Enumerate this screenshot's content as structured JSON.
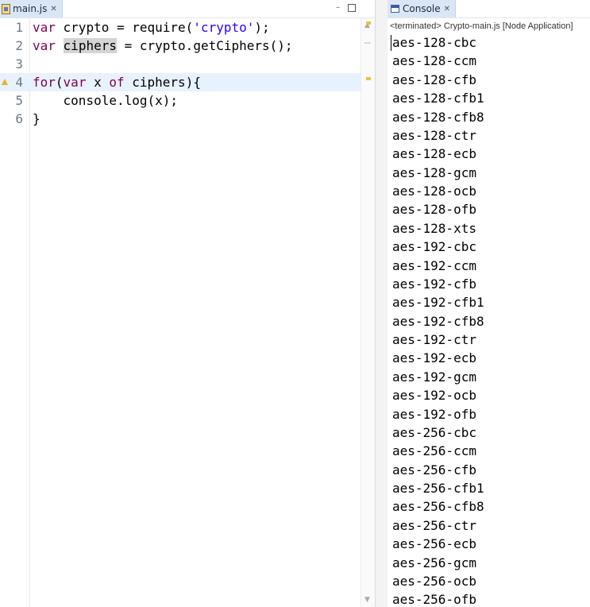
{
  "editor": {
    "tab_title": "main.js",
    "tab_close": "✕",
    "minimize": "–",
    "lines": [
      {
        "num": "1",
        "segments": [
          {
            "t": "var",
            "c": "kw"
          },
          {
            "t": " crypto = require(",
            "c": ""
          },
          {
            "t": "'crypto'",
            "c": "str"
          },
          {
            "t": ");",
            "c": ""
          }
        ]
      },
      {
        "num": "2",
        "segments": [
          {
            "t": "var",
            "c": "kw"
          },
          {
            "t": " ",
            "c": ""
          },
          {
            "t": "ciphers",
            "c": "occ"
          },
          {
            "t": " = crypto.getCiphers();",
            "c": ""
          }
        ]
      },
      {
        "num": "3",
        "segments": []
      },
      {
        "num": "4",
        "active": true,
        "warning": true,
        "segments": [
          {
            "t": "for",
            "c": "kw"
          },
          {
            "t": "(",
            "c": ""
          },
          {
            "t": "var",
            "c": "kw"
          },
          {
            "t": " x ",
            "c": ""
          },
          {
            "t": "of",
            "c": "kw"
          },
          {
            "t": " ciphers){",
            "c": ""
          }
        ]
      },
      {
        "num": "5",
        "segments": [
          {
            "t": "    console.log(x);",
            "c": ""
          }
        ]
      },
      {
        "num": "6",
        "segments": [
          {
            "t": "}",
            "c": ""
          }
        ]
      }
    ]
  },
  "console": {
    "tab_title": "Console",
    "tab_close": "✕",
    "status": "<terminated> Crypto-main.js [Node Application]",
    "output": [
      "aes-128-cbc",
      "aes-128-ccm",
      "aes-128-cfb",
      "aes-128-cfb1",
      "aes-128-cfb8",
      "aes-128-ctr",
      "aes-128-ecb",
      "aes-128-gcm",
      "aes-128-ocb",
      "aes-128-ofb",
      "aes-128-xts",
      "aes-192-cbc",
      "aes-192-ccm",
      "aes-192-cfb",
      "aes-192-cfb1",
      "aes-192-cfb8",
      "aes-192-ctr",
      "aes-192-ecb",
      "aes-192-gcm",
      "aes-192-ocb",
      "aes-192-ofb",
      "aes-256-cbc",
      "aes-256-ccm",
      "aes-256-cfb",
      "aes-256-cfb1",
      "aes-256-cfb8",
      "aes-256-ctr",
      "aes-256-ecb",
      "aes-256-gcm",
      "aes-256-ocb",
      "aes-256-ofb"
    ]
  },
  "icons": {
    "editor_tab": "js-file-icon",
    "console_tab": "console-icon",
    "warning": "warning-icon"
  }
}
